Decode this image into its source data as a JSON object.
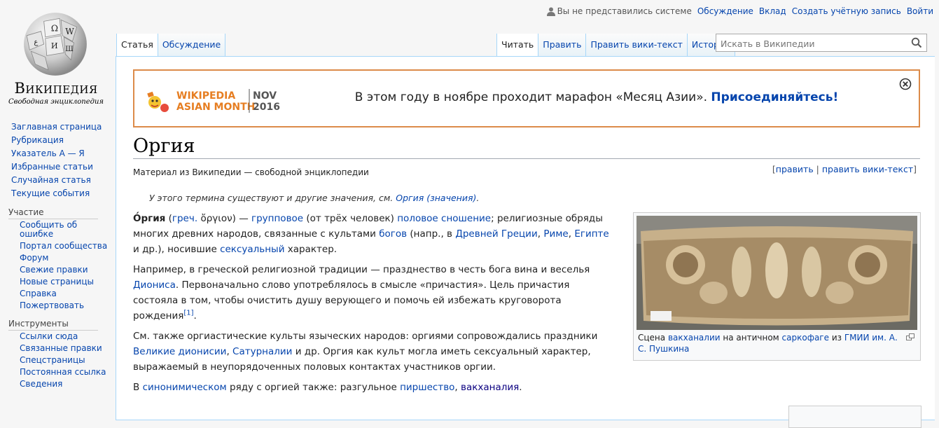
{
  "logo": {
    "wordmark": "Википедия",
    "tagline": "Свободная энциклопедия"
  },
  "personal": {
    "anon": "Вы не представились системе",
    "links": [
      "Обсуждение",
      "Вклад",
      "Создать учётную запись",
      "Войти"
    ]
  },
  "sidebar": {
    "main": [
      "Заглавная страница",
      "Рубрикация",
      "Указатель А — Я",
      "Избранные статьи",
      "Случайная статья",
      "Текущие события"
    ],
    "participation": {
      "title": "Участие",
      "items": [
        "Сообщить об ошибке",
        "Портал сообщества",
        "Форум",
        "Свежие правки",
        "Новые страницы",
        "Справка",
        "Пожертвовать"
      ]
    },
    "tools": {
      "title": "Инструменты",
      "items": [
        "Ссылки сюда",
        "Связанные правки",
        "Спецстраницы",
        "Постоянная ссылка",
        "Сведения"
      ]
    }
  },
  "tabs": {
    "left": [
      "Статья",
      "Обсуждение"
    ],
    "right": [
      "Читать",
      "Править",
      "Править вики-текст",
      "История"
    ]
  },
  "search": {
    "placeholder": "Искать в Википедии"
  },
  "banner": {
    "logo_line1": "WIKIPEDIA",
    "logo_line2": "ASIAN MONTH",
    "logo_month": "NOV",
    "logo_year": "2016",
    "text": "В этом году в ноябре проходит марафон «Месяц Азии».",
    "link": "Присоединяйтесь!"
  },
  "article": {
    "title": "Оргия",
    "site_sub": "Материал из Википедии — свободной энциклопедии",
    "edit_links": {
      "edit": "править",
      "edit_source": "править вики-текст"
    },
    "hatnote_text": "У этого термина существуют и другие значения, см.",
    "hatnote_link": "Оргия (значения)",
    "p1": {
      "bold": "О́ргия",
      "lang": "греч.",
      "greek": "ὄργιον",
      "t1": " — ",
      "l1": "групповое",
      "t2": " (от трёх человек) ",
      "l2": "половое сношение",
      "t3": "; религиозные обряды многих древних народов, связанные с культами ",
      "l3": "богов",
      "t4": " (напр., в ",
      "l4": "Древней Греции",
      "l5": "Риме",
      "l6": "Египте",
      "t5": " и др.), носившие ",
      "l7": "сексуальный",
      "t6": " характер."
    },
    "p2": {
      "t1": "Например, в греческой религиозной традиции — празднество в честь бога вина и веселья ",
      "l1": "Диониса",
      "t2": ". Первоначально слово употреблялось в смысле «причастия». Цель причастия состояла в том, чтобы очистить душу верующего и помочь ей избежать круговорота рождения",
      "ref": "[1]"
    },
    "p3": {
      "t1": "См. также оргиастические культы языческих народов: оргиями сопровождались праздники ",
      "l1": "Великие дионисии",
      "l2": "Сатурналии",
      "t2": " и др. Оргия как культ могла иметь сексуальный характер, выражаемый в неупорядоченных половых контактах участников оргии."
    },
    "p4": {
      "t1": "В ",
      "l1": "синонимическом",
      "t2": " ряду с оргией также: разгульное ",
      "l2": "пиршество",
      "l3": "вакханалия"
    },
    "caption": {
      "t1": "Сцена ",
      "l1": "вакханалии",
      "t2": " на античном ",
      "l2": "саркофаге",
      "t3": " из ",
      "l3": "ГМИИ им. А. С. Пушкина"
    }
  },
  "colors": {
    "link": "#0645ad",
    "banner_border": "#dc8b4a",
    "tab_border": "#a7d7f9"
  }
}
